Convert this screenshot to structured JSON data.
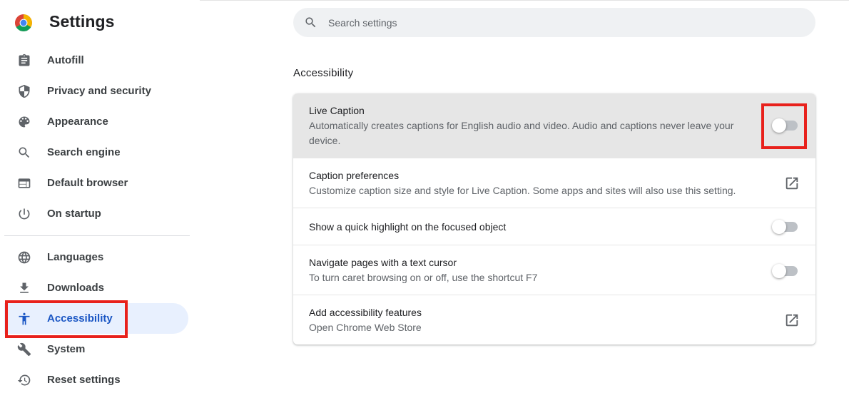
{
  "app": {
    "title": "Settings"
  },
  "search": {
    "placeholder": "Search settings"
  },
  "sidebar": {
    "items": [
      {
        "label": "Autofill",
        "icon": "clipboard-icon"
      },
      {
        "label": "Privacy and security",
        "icon": "shield-icon"
      },
      {
        "label": "Appearance",
        "icon": "palette-icon"
      },
      {
        "label": "Search engine",
        "icon": "search-icon"
      },
      {
        "label": "Default browser",
        "icon": "browser-window-icon"
      },
      {
        "label": "On startup",
        "icon": "power-icon"
      },
      {
        "label": "Languages",
        "icon": "globe-icon"
      },
      {
        "label": "Downloads",
        "icon": "download-icon"
      },
      {
        "label": "Accessibility",
        "icon": "accessibility-icon",
        "active": true
      },
      {
        "label": "System",
        "icon": "wrench-icon"
      },
      {
        "label": "Reset settings",
        "icon": "restore-icon"
      }
    ]
  },
  "main": {
    "section_title": "Accessibility",
    "rows": [
      {
        "title": "Live Caption",
        "subtitle": "Automatically creates captions for English audio and video. Audio and captions never leave your device.",
        "control": "toggle",
        "on": false
      },
      {
        "title": "Caption preferences",
        "subtitle": "Customize caption size and style for Live Caption. Some apps and sites will also use this setting.",
        "control": "external-link"
      },
      {
        "title": "Show a quick highlight on the focused object",
        "control": "toggle",
        "on": false
      },
      {
        "title": "Navigate pages with a text cursor",
        "subtitle": "To turn caret browsing on or off, use the shortcut F7",
        "control": "toggle",
        "on": false
      },
      {
        "title": "Add accessibility features",
        "subtitle": "Open Chrome Web Store",
        "control": "external-link"
      }
    ]
  },
  "colors": {
    "active_nav_bg": "#e8f0fe",
    "active_nav_text": "#1a56c4",
    "highlight_box": "#e8211c",
    "toggle_off_track": "#bdc1c6"
  }
}
